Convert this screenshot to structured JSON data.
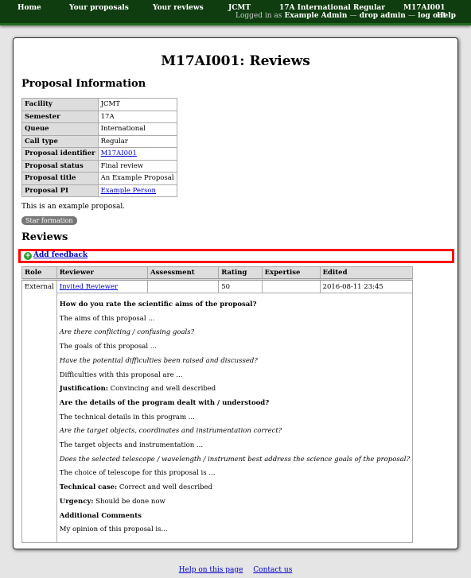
{
  "nav": {
    "home": "Home",
    "your_proposals": "Your proposals",
    "your_reviews": "Your reviews",
    "facility": "JCMT",
    "call": "17A International Regular",
    "proposal_code": "M17AI001",
    "logged_in_prefix": "Logged in as",
    "user": "Example Admin",
    "sep1": "—",
    "drop_admin": "drop admin",
    "sep2": "—",
    "logout": "log out",
    "help": "Help"
  },
  "page": {
    "title": "M17AI001: Reviews",
    "info_heading": "Proposal Information",
    "description": "This is an example proposal.",
    "tag": "Star formation",
    "reviews_heading": "Reviews",
    "add_feedback": "Add feedback"
  },
  "info": {
    "rows": [
      {
        "label": "Facility",
        "value": "JCMT"
      },
      {
        "label": "Semester",
        "value": "17A"
      },
      {
        "label": "Queue",
        "value": "International"
      },
      {
        "label": "Call type",
        "value": "Regular"
      },
      {
        "label": "Proposal identifier",
        "value": "M17AI001"
      },
      {
        "label": "Proposal status",
        "value": "Final review"
      },
      {
        "label": "Proposal title",
        "value": "An Example Proposal"
      },
      {
        "label": "Proposal PI",
        "value": "Example Person"
      }
    ]
  },
  "reviews": {
    "headers": [
      "Role",
      "Reviewer",
      "Assessment",
      "Rating",
      "Expertise",
      "Edited"
    ],
    "row": {
      "role": "External",
      "reviewer": "Invited Reviewer",
      "assessment": "",
      "rating": "50",
      "expertise": "",
      "edited": "2016-08-11 23:45"
    },
    "body": {
      "q1": "How do you rate the scientific aims of the proposal?",
      "a1": "The aims of this proposal ...",
      "i1": "Are there conflicting / confusing goals?",
      "a2": "The goals of this proposal ...",
      "i2": "Have the potential difficulties been raised and discussed?",
      "a3": "Difficulties with this proposal are ...",
      "just_label": "Justification:",
      "just_value": "Convincing and well described",
      "q2": "Are the details of the program dealt with / understood?",
      "a4": "The technical details in this program ...",
      "i3": "Are the target objects, coordinates and instrumentation correct?",
      "a5": "The target objects and instrumentation ...",
      "i4": "Does the selected telescope / wavelength / instrument best address the science goals of the proposal?",
      "a6": "The choice of telescope for this proposal is ...",
      "tech_label": "Technical case:",
      "tech_value": "Correct and well described",
      "urg_label": "Urgency:",
      "urg_value": "Should be done now",
      "q3": "Additional Comments",
      "a7": "My opinion of this proposal is..."
    }
  },
  "footer": {
    "help": "Help on this page",
    "contact": "Contact us"
  }
}
